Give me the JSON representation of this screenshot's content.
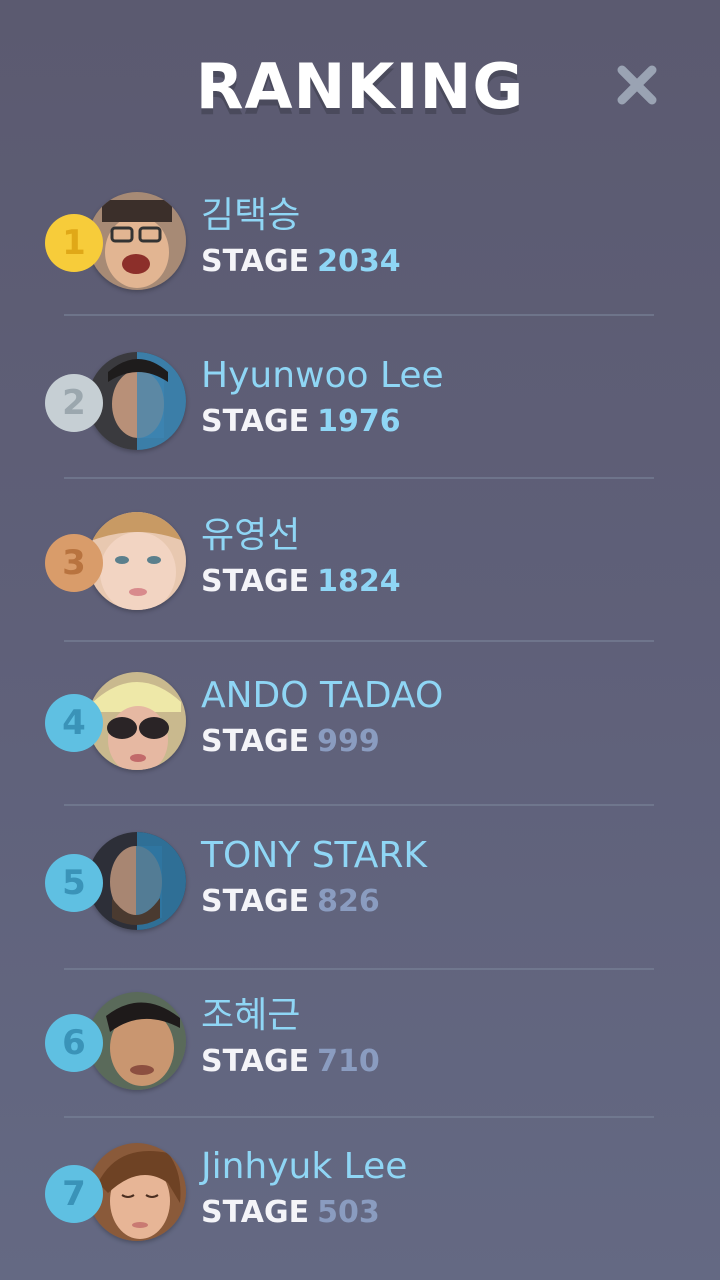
{
  "header": {
    "title": "RANKING",
    "close_icon": "close-icon"
  },
  "colors": {
    "name": "#8fd6f5",
    "stage_label": "#f4f4f8",
    "stage_value_top": "#8fd6f5",
    "stage_value_rest": "#8a9cc0",
    "badge_gold": "#f7cc3a",
    "badge_silver": "#c6cfd4",
    "badge_bronze": "#d99c6a",
    "badge_blue": "#5fc0e2"
  },
  "rankings": [
    {
      "rank": "1",
      "name": "김택승",
      "stage_label": "STAGE",
      "stage": "2034",
      "badge": "gold",
      "avatar": "avatar-photo"
    },
    {
      "rank": "2",
      "name": "Hyunwoo Lee",
      "stage_label": "STAGE",
      "stage": "1976",
      "badge": "silver",
      "avatar": "avatar-photo"
    },
    {
      "rank": "3",
      "name": "유영선",
      "stage_label": "STAGE",
      "stage": "1824",
      "badge": "bronze",
      "avatar": "avatar-photo"
    },
    {
      "rank": "4",
      "name": "ANDO TADAO",
      "stage_label": "STAGE",
      "stage": "999",
      "badge": "blue",
      "avatar": "avatar-photo"
    },
    {
      "rank": "5",
      "name": "TONY STARK",
      "stage_label": "STAGE",
      "stage": "826",
      "badge": "blue",
      "avatar": "avatar-photo"
    },
    {
      "rank": "6",
      "name": "조혜근",
      "stage_label": "STAGE",
      "stage": "710",
      "badge": "blue",
      "avatar": "avatar-photo"
    },
    {
      "rank": "7",
      "name": "Jinhyuk Lee",
      "stage_label": "STAGE",
      "stage": "503",
      "badge": "blue",
      "avatar": "avatar-photo"
    }
  ]
}
